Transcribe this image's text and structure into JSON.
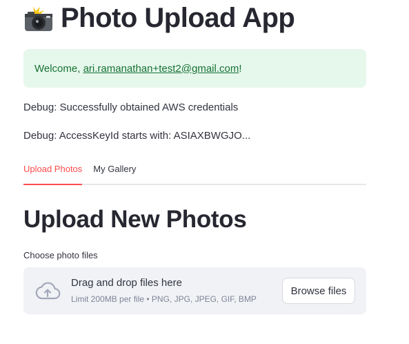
{
  "app": {
    "title_icon": "camera-with-flash-icon",
    "title": "Photo Upload App"
  },
  "welcome": {
    "prefix": "Welcome, ",
    "email": "ari.ramanathan+test2@gmail.com",
    "suffix": "!"
  },
  "debug": {
    "line1": "Debug: Successfully obtained AWS credentials",
    "line2": "Debug: AccessKeyId starts with: ASIAXBWGJO..."
  },
  "tabs": [
    {
      "label": "Upload Photos",
      "active": true
    },
    {
      "label": "My Gallery",
      "active": false
    }
  ],
  "upload": {
    "heading": "Upload New Photos",
    "field_label": "Choose photo files",
    "drop_text": "Drag and drop files here",
    "limit_text": "Limit 200MB per file • PNG, JPG, JPEG, GIF, BMP",
    "browse_label": "Browse files",
    "icon": "cloud-upload-icon"
  },
  "colors": {
    "accent": "#ff4b4b",
    "success_bg": "#e6f7ec",
    "success_text": "#177233",
    "dropzone_bg": "#f0f2f6"
  }
}
